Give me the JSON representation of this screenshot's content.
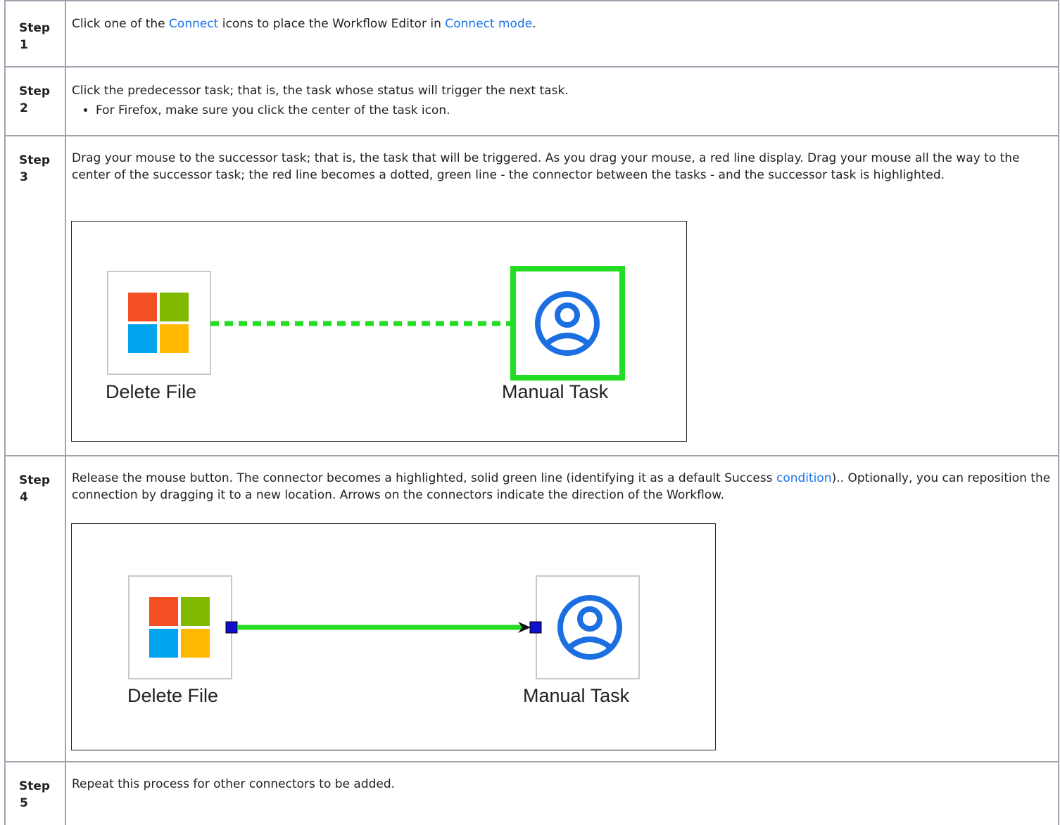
{
  "steps": [
    {
      "label_line1": "Step",
      "label_line2": "1",
      "text_before": "Click one of the ",
      "link1": "Connect",
      "text_mid": " icons to place the Workflow Editor in ",
      "link2": "Connect mode",
      "text_after": "."
    },
    {
      "label_line1": "Step",
      "label_line2": "2",
      "text": "Click the predecessor task; that is, the task whose status will trigger the next task.",
      "bullets": [
        "For Firefox, make sure you click the center of the task icon."
      ]
    },
    {
      "label_line1": "Step",
      "label_line2": "3",
      "text": "Drag your mouse to the successor task; that is, the task that will be triggered. As you drag your mouse, a red line display. Drag your mouse all the way to the center of the successor task; the red line becomes a dotted, green line - the connector between the tasks - and the successor task is highlighted.",
      "figure": {
        "left_task": "Delete File",
        "right_task": "Manual Task",
        "connector": "dotted-green",
        "highlight_color": "#22dd22"
      }
    },
    {
      "label_line1": "Step",
      "label_line2": "4",
      "text_before": "Release the mouse button. The connector becomes a highlighted, solid green line (identifying it as a default Success ",
      "link1": "condition",
      "text_after": ").. Optionally, you can reposition the connection by dragging it to a new location. Arrows on the connectors indicate the direction of the Workflow.",
      "figure": {
        "left_task": "Delete File",
        "right_task": "Manual Task",
        "connector": "solid-green-arrow",
        "anchor_color": "#1010cc"
      }
    },
    {
      "label_line1": "Step",
      "label_line2": "5",
      "text": "Repeat this process for other connectors to be added."
    }
  ],
  "colors": {
    "link": "#1a73e8",
    "border": "#a3a3b0",
    "ms_red": "#f25022",
    "ms_green": "#7fba00",
    "ms_blue": "#00a4ef",
    "ms_yellow": "#ffb900",
    "user_icon": "#1c6fe0",
    "connector_green": "#22dd22"
  },
  "icons": {
    "left_task_icon": "microsoft-windows-logo-icon",
    "right_task_icon": "user-circle-icon"
  }
}
